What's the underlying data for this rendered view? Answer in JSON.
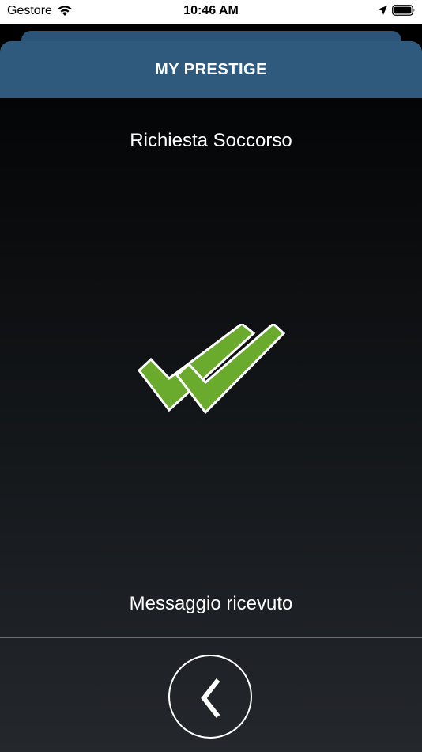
{
  "status_bar": {
    "carrier": "Gestore",
    "time": "10:46 AM",
    "icons": [
      "wifi-icon",
      "location-arrow-icon",
      "battery-icon"
    ]
  },
  "header": {
    "title": "MY PRESTIGE"
  },
  "main": {
    "title": "Richiesta Soccorso",
    "status_message": "Messaggio ricevuto",
    "status_icon": "double-check-icon"
  },
  "footer": {
    "back_icon": "chevron-left-icon"
  },
  "colors": {
    "header_bg": "#2f5a7e",
    "check_green": "#6aaa2c",
    "background_top": "#040506",
    "background_bottom": "#24272c"
  }
}
